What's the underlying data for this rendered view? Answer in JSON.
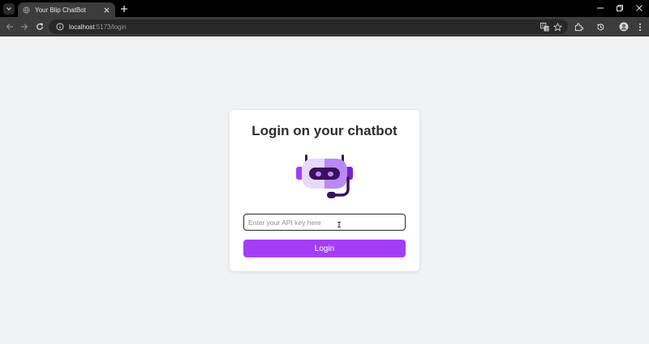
{
  "browser": {
    "tab": {
      "title": "Your Blip ChatBot"
    },
    "address": {
      "host": "localhost",
      "path": ":5173/login"
    }
  },
  "login": {
    "title": "Login on your chatbot",
    "api_key_input": {
      "placeholder": "Enter your API key here",
      "value": ""
    },
    "login_button_label": "Login"
  },
  "colors": {
    "accent": "#a43ef5",
    "robot_light": "#e6d9fb",
    "robot_mid": "#b98af3",
    "robot_dark": "#3c0f5e"
  },
  "icons": [
    "tab-search-icon",
    "globe-icon",
    "close-icon",
    "plus-icon",
    "minimize-icon",
    "restore-icon",
    "window-close-icon",
    "back-arrow-icon",
    "forward-arrow-icon",
    "reload-icon",
    "site-info-icon",
    "translate-icon",
    "star-icon",
    "extensions-icon",
    "history-icon",
    "profile-icon",
    "more-icon",
    "robot-headset-icon"
  ]
}
